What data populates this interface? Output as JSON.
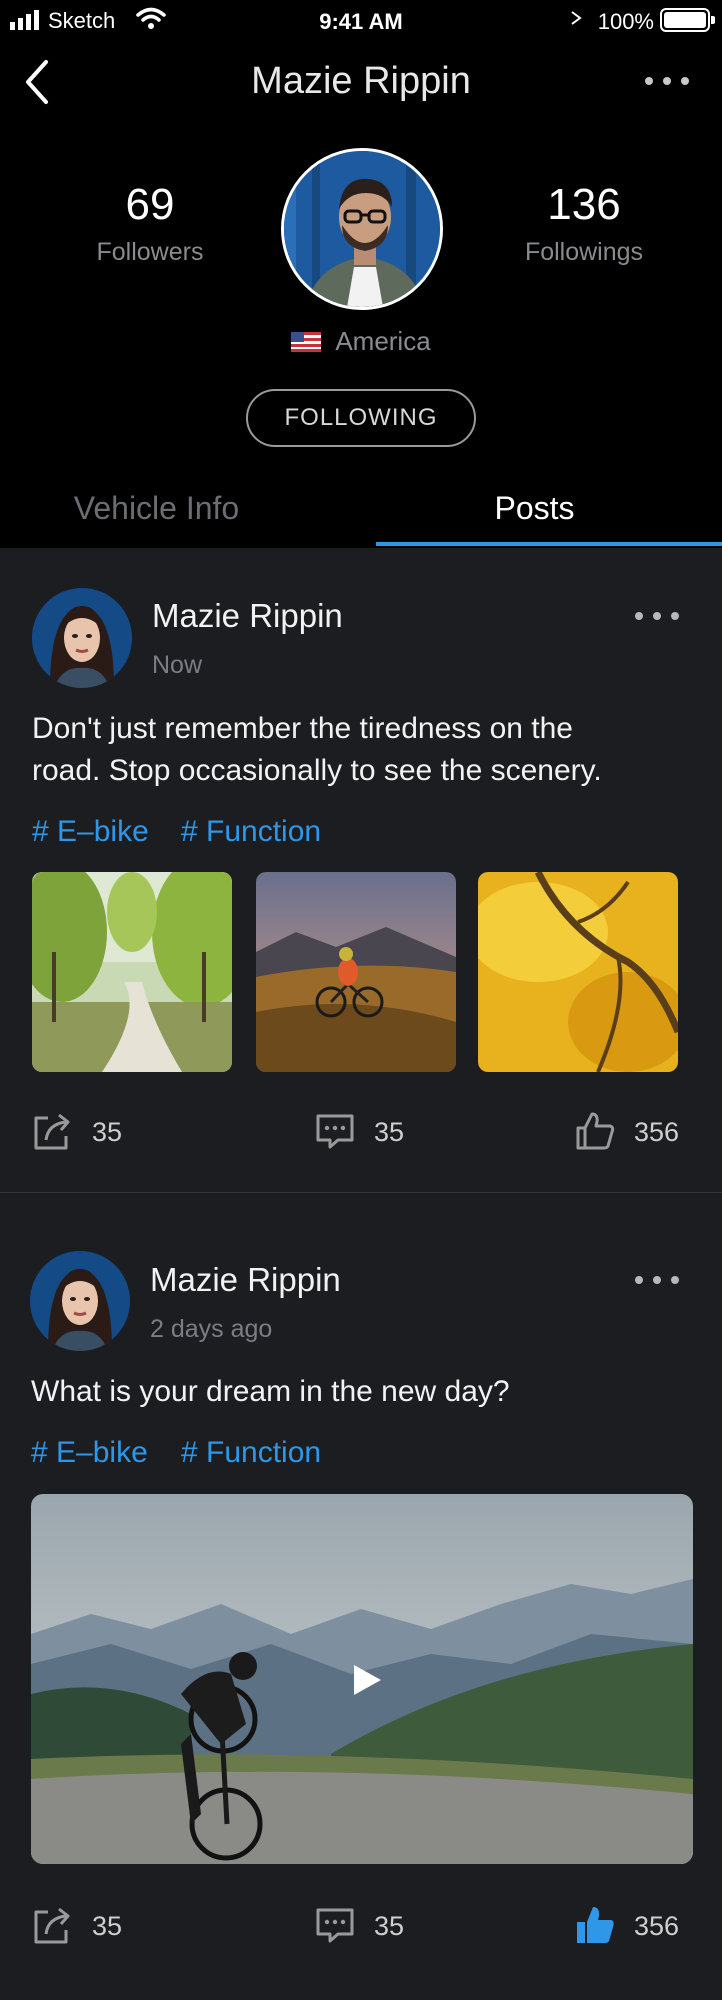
{
  "status_bar": {
    "carrier": "Sketch",
    "time": "9:41 AM",
    "battery": "100%"
  },
  "nav": {
    "title": "Mazie Rippin"
  },
  "profile": {
    "followers_count": "69",
    "followers_label": "Followers",
    "followings_count": "136",
    "followings_label": "Followings",
    "country": "America",
    "follow_button": "FOLLOWING"
  },
  "tabs": {
    "vehicle_info": "Vehicle Info",
    "posts": "Posts",
    "active": "Posts"
  },
  "posts": [
    {
      "author": "Mazie Rippin",
      "time": "Now",
      "text_line1": "Don't just remember the tiredness on the",
      "text_line2": "road. Stop occasionally to see the scenery.",
      "tags": [
        "# E–bike",
        "# Function"
      ],
      "shares": "35",
      "comments": "35",
      "likes": "356",
      "liked": false
    },
    {
      "author": "Mazie Rippin",
      "time": "2 days ago",
      "text_line1": "What is your dream in the new day?",
      "tags": [
        "# E–bike",
        "# Function"
      ],
      "shares": "35",
      "comments": "35",
      "likes": "356",
      "liked": true
    }
  ],
  "colors": {
    "accent": "#2E97E8",
    "background": "#1C1D21",
    "header": "#000000"
  }
}
